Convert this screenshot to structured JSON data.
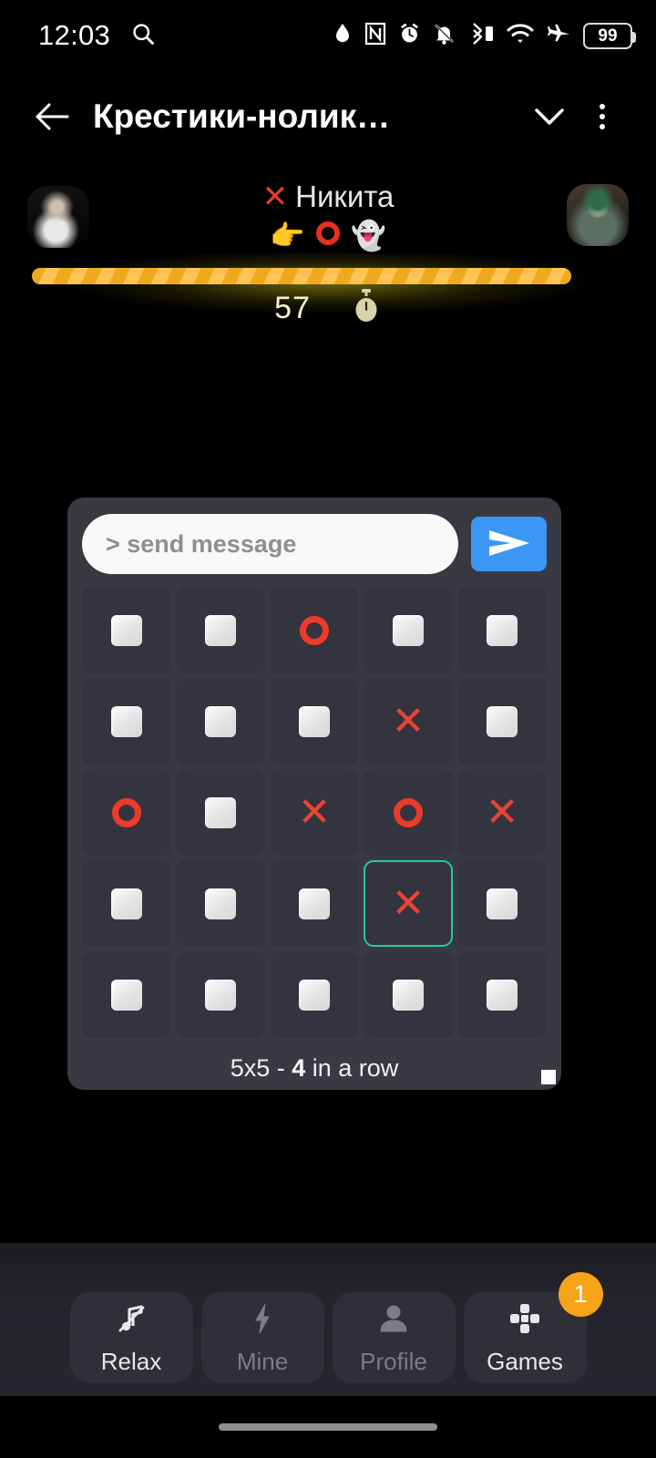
{
  "statusbar": {
    "time": "12:03",
    "battery_level": "99",
    "icons": [
      "search-icon",
      "water-drop-icon",
      "nfc-icon",
      "alarm-clock-icon",
      "bell-muted-icon",
      "bluetooth-battery-icon",
      "wifi-icon",
      "airplane-mode-icon",
      "battery-icon"
    ]
  },
  "appbar": {
    "title": "Крестики-нолик…",
    "back_icon": "arrow-left-icon",
    "collapse_icon": "chevron-down-icon",
    "overflow_icon": "more-vertical-icon"
  },
  "players": {
    "turn_mark": "✕",
    "turn_name": "Никита",
    "status_row": [
      "👉",
      "O",
      "👻"
    ],
    "left_avatar": "player-left-avatar",
    "right_avatar": "player-right-avatar"
  },
  "timer": {
    "value": "57",
    "icon": "stopwatch-icon",
    "progress_percent": 100,
    "bar_color": "#f0a91f"
  },
  "game": {
    "message_placeholder": "> send message",
    "message_value": "",
    "send_icon": "send-icon",
    "caption_prefix": "5x5 - ",
    "caption_bold": "4",
    "caption_suffix": " in a row",
    "highlight_color": "#29c99a",
    "mark_color": "#e84434",
    "board": [
      [
        "empty",
        "empty",
        "O",
        "empty",
        "empty"
      ],
      [
        "empty",
        "empty",
        "empty",
        "X",
        "empty"
      ],
      [
        "O",
        "empty",
        "X",
        "O",
        "X"
      ],
      [
        "empty",
        "empty",
        "empty",
        "X",
        "empty"
      ],
      [
        "empty",
        "empty",
        "empty",
        "empty",
        "empty"
      ]
    ],
    "highlight_cell": [
      3,
      3
    ],
    "resize_handle": "resize-handle"
  },
  "bottom_nav": {
    "items": [
      {
        "label": "Relax",
        "icon": "music-off-icon",
        "active": true,
        "badge": ""
      },
      {
        "label": "Mine",
        "icon": "lightning-icon",
        "active": false,
        "badge": ""
      },
      {
        "label": "Profile",
        "icon": "person-icon",
        "active": false,
        "badge": ""
      },
      {
        "label": "Games",
        "icon": "dpad-icon",
        "active": true,
        "badge": "1"
      }
    ],
    "badge_color": "#f5a41a"
  }
}
